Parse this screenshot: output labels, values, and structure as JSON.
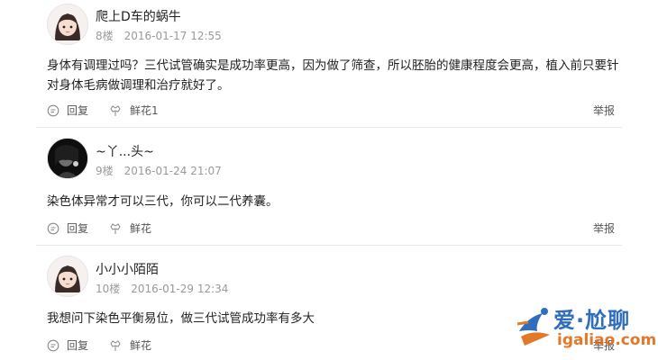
{
  "posts": [
    {
      "username": "爬上D车的蜗牛",
      "floor": "8楼",
      "time": "2016-01-17 12:55",
      "body": "身体有调理过吗？三代试管确实是成功率更高，因为做了筛查，所以胚胎的健康程度会更高，植入前只要针对身体毛病做调理和治疗就好了。",
      "reply_label": "回复",
      "flower_label": "鲜花1",
      "report_label": "举报",
      "avatar": "girl-cartoon"
    },
    {
      "username": "~丫...头~",
      "floor": "9楼",
      "time": "2016-01-24 21:07",
      "body": "染色体异常才可以三代，你可以二代养囊。",
      "reply_label": "回复",
      "flower_label": "鲜花",
      "report_label": "举报",
      "avatar": "dark-photo"
    },
    {
      "username": "小小小陌陌",
      "floor": "10楼",
      "time": "2016-01-29 12:34",
      "body": "我想问下染色平衡易位，做三代试管成功率有多大",
      "reply_label": "回复",
      "flower_label": "鲜花",
      "report_label": "举报",
      "avatar": "girl-cartoon"
    }
  ],
  "watermark": {
    "cn": "爱·尬聊",
    "url": "igaliao.com",
    "logo": "runner-logo"
  },
  "icons": {
    "reply": "reply-icon",
    "flower": "flower-icon"
  },
  "colors": {
    "meta": "#9a9a9a",
    "divider": "#e9e9e9",
    "wm_blue": "#1a5fb4",
    "wm_orange": "#e06a12"
  }
}
